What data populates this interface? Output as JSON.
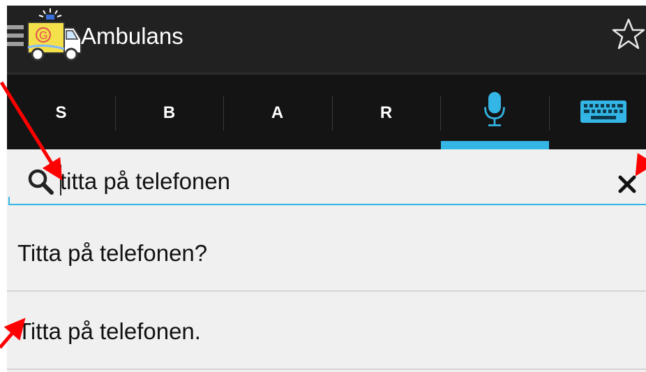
{
  "app": {
    "title": "Ambulans",
    "icon": "ambulance-icon",
    "menu_icon": "hamburger-icon",
    "favorite_icon": "star-outline-icon"
  },
  "tabs": [
    {
      "label": "S",
      "type": "text"
    },
    {
      "label": "B",
      "type": "text"
    },
    {
      "label": "A",
      "type": "text"
    },
    {
      "label": "R",
      "type": "text"
    },
    {
      "label": "",
      "type": "icon",
      "icon": "microphone-icon",
      "selected": true
    },
    {
      "label": "",
      "type": "icon",
      "icon": "keyboard-icon"
    }
  ],
  "search": {
    "value": "titta på telefonen",
    "search_icon": "search-icon",
    "clear_icon": "close-icon"
  },
  "suggestions": [
    {
      "text": "Titta på telefonen?"
    },
    {
      "text": "Titta på telefonen."
    }
  ],
  "colors": {
    "accent": "#33b5e5",
    "annotation": "#ff0000",
    "actionbar": "#212121",
    "tabbar": "#141414",
    "background": "#f0f0f0"
  }
}
